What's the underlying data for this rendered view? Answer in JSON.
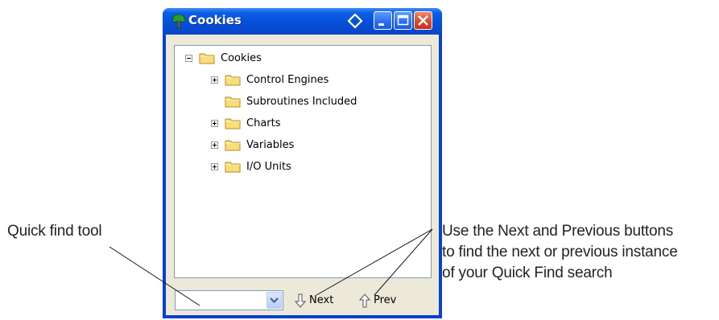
{
  "window": {
    "title": "Cookies",
    "icon": "tree-icon",
    "buttons": [
      "pin-diamond",
      "minimize",
      "maximize",
      "close"
    ]
  },
  "tree": {
    "root": "Cookies",
    "items": [
      {
        "label": "Control Engines",
        "expandable": true
      },
      {
        "label": "Subroutines Included",
        "expandable": false
      },
      {
        "label": "Charts",
        "expandable": true
      },
      {
        "label": "Variables",
        "expandable": true
      },
      {
        "label": "I/O Units",
        "expandable": true
      }
    ]
  },
  "quickfind": {
    "value": "",
    "next_label": "Next",
    "prev_label": "Prev"
  },
  "callouts": {
    "left": "Quick find tool",
    "right_line1": "Use the Next and Previous buttons",
    "right_line2": "to find the next or previous instance",
    "right_line3": "of your Quick Find search"
  },
  "colors": {
    "titlebar": "#0650d8",
    "close_button": "#d9442a",
    "client": "#ece9d8",
    "folder": "#f2cf55"
  }
}
